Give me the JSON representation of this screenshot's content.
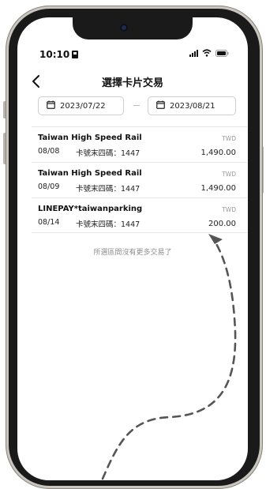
{
  "status_bar": {
    "time": "10:10"
  },
  "header": {
    "title": "選擇卡片交易"
  },
  "date_range": {
    "start": "2023/07/22",
    "end": "2023/08/21"
  },
  "transactions": [
    {
      "merchant": "Taiwan High Speed Rail",
      "date": "08/08",
      "card": "卡號末四碼：1447",
      "currency": "TWD",
      "amount": "1,490.00"
    },
    {
      "merchant": "Taiwan High Speed Rail",
      "date": "08/09",
      "card": "卡號末四碼：1447",
      "currency": "TWD",
      "amount": "1,490.00"
    },
    {
      "merchant": "LINEPAY*taiwanparking",
      "date": "08/14",
      "card": "卡號末四碼：1447",
      "currency": "TWD",
      "amount": "200.00"
    }
  ],
  "footer_note": "所選區間沒有更多交易了",
  "icons": [
    "back-arrow-icon",
    "calendar-icon",
    "signal-icon",
    "wifi-icon",
    "battery-icon",
    "sim-icon"
  ],
  "colors": {
    "frame": "#c9c5bf",
    "bezel": "#1a1a1a",
    "text": "#111111",
    "muted": "#8f8f8f",
    "divider": "#e6e6e6"
  }
}
